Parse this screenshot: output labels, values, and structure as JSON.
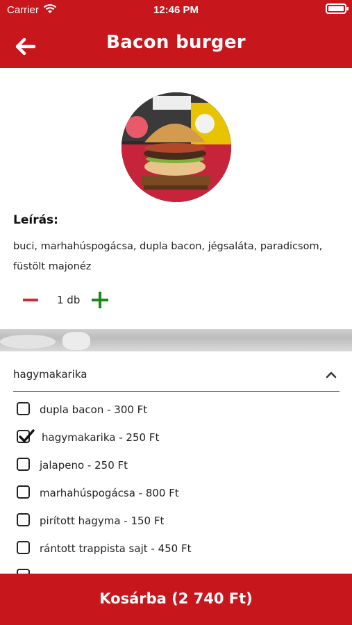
{
  "status_bar": {
    "carrier": "Carrier",
    "time": "12:46 PM"
  },
  "header": {
    "title": "Bacon burger",
    "back_icon": "arrow-left-icon"
  },
  "product": {
    "image_alt": "bacon burger photo",
    "description_label": "Leírás:",
    "description": "buci, marhahúspogácsa, dupla bacon, jégsaláta, paradicsom, füstölt majonéz",
    "quantity_text": "1 db"
  },
  "extras": {
    "header": "hagymakarika",
    "expanded": true,
    "options": [
      {
        "label": "dupla bacon - 300 Ft",
        "checked": false
      },
      {
        "label": "hagymakarika - 250 Ft",
        "checked": true
      },
      {
        "label": "jalapeno - 250 Ft",
        "checked": false
      },
      {
        "label": "marhahúspogácsa - 800 Ft",
        "checked": false
      },
      {
        "label": "pirított hagyma - 150 Ft",
        "checked": false
      },
      {
        "label": "rántott trappista sajt - 450 Ft",
        "checked": false
      }
    ]
  },
  "footer": {
    "cart_button": "Kosárba (2 740 Ft)"
  },
  "colors": {
    "primary_red": "#c8161d",
    "minus_red": "#d7262c",
    "plus_green": "#1b8a1b"
  }
}
